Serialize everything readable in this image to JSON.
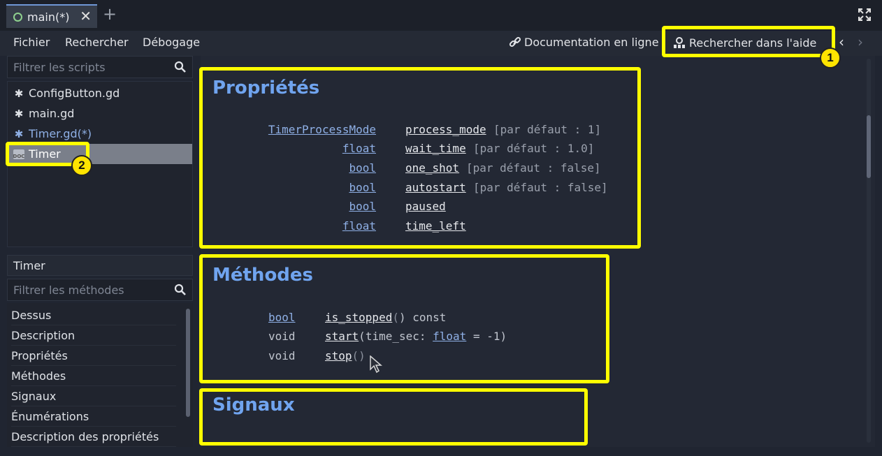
{
  "tabs": [
    {
      "label": "main(*)"
    }
  ],
  "menu": {
    "file": "Fichier",
    "search": "Rechercher",
    "debug": "Débogage",
    "online_docs": "Documentation en ligne",
    "search_help": "Rechercher dans l'aide"
  },
  "scripts_filter": {
    "placeholder": "Filtrer les scripts"
  },
  "scripts": [
    {
      "label": "ConfigButton.gd",
      "icon": "gear-icon"
    },
    {
      "label": "main.gd",
      "icon": "gear-icon"
    },
    {
      "label": "Timer.gd(*)",
      "icon": "gear-icon",
      "modified": true
    },
    {
      "label": "Timer",
      "icon": "doc-icon",
      "selected": true
    }
  ],
  "class_name": "Timer",
  "methods_filter": {
    "placeholder": "Filtrer les méthodes"
  },
  "sections_list": [
    "Dessus",
    "Description",
    "Propriétés",
    "Méthodes",
    "Signaux",
    "Énumérations",
    "Description des propriétés"
  ],
  "doc": {
    "properties_title": "Propriétés",
    "properties": [
      {
        "type": "TimerProcessMode",
        "name": "process_mode",
        "default": "[par défaut : 1]"
      },
      {
        "type": "float",
        "name": "wait_time",
        "default": "[par défaut : 1.0]"
      },
      {
        "type": "bool",
        "name": "one_shot",
        "default": "[par défaut : false]"
      },
      {
        "type": "bool",
        "name": "autostart",
        "default": "[par défaut : false]"
      },
      {
        "type": "bool",
        "name": "paused",
        "default": ""
      },
      {
        "type": "float",
        "name": "time_left",
        "default": ""
      }
    ],
    "methods_title": "Méthodes",
    "methods": [
      {
        "ret": "bool",
        "name": "is_stopped",
        "args_open": "(",
        "args_close": ") const",
        "param": "",
        "param_type": "",
        "param_default": ""
      },
      {
        "ret": "void",
        "name": "start",
        "args_open": "(",
        "param": "time_sec: ",
        "param_type": "float",
        "param_default": " = -1",
        "args_close": ")"
      },
      {
        "ret": "void",
        "name": "stop",
        "args_open": "(",
        "args_close": ")",
        "param": "",
        "param_type": "",
        "param_default": ""
      }
    ],
    "signals_title": "Signaux"
  },
  "annotations": {
    "badge_1": "1",
    "badge_2": "2"
  },
  "colors": {
    "highlight": "#ffff00",
    "accent": "#70a4ef",
    "link": "#8fb0e6"
  }
}
